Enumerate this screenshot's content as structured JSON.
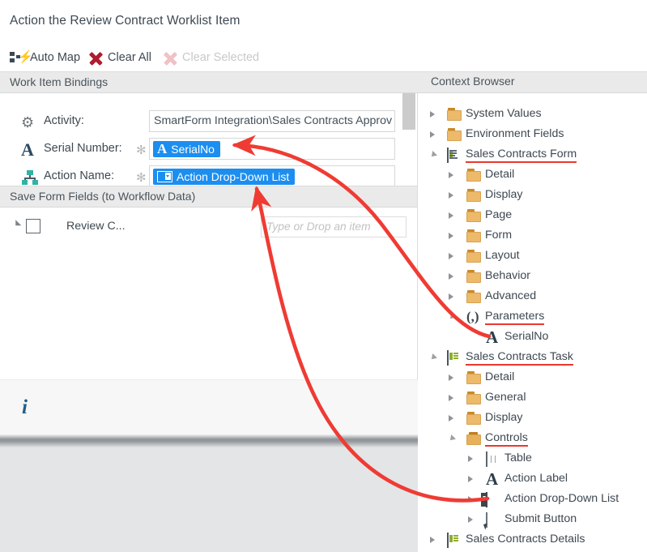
{
  "window": {
    "title": "Action the Review Contract Worklist Item"
  },
  "toolbar": {
    "buttons": [
      {
        "label": "Auto Map",
        "icon": "auto-map-icon",
        "enabled": true
      },
      {
        "label": "Clear All",
        "icon": "red-x-icon",
        "enabled": true
      },
      {
        "label": "Clear Selected",
        "icon": "red-x-icon",
        "enabled": false
      }
    ]
  },
  "panels": {
    "left_header": "Work Item Bindings",
    "right_header": "Context Browser",
    "save_section_header": "Save Form Fields (to Workflow Data)"
  },
  "bindings": {
    "rows": [
      {
        "icon": "gear-icon",
        "label": "Activity:",
        "required": false,
        "value_type": "text",
        "value": "SmartForm Integration\\Sales Contracts Approv"
      },
      {
        "icon": "letter-a-icon",
        "label": "Serial Number:",
        "required": true,
        "required_mark": "✻",
        "value_type": "chip",
        "chip_icon": "letter-a-icon",
        "value": "SerialNo"
      },
      {
        "icon": "org-chart-icon",
        "label": "Action Name:",
        "required": true,
        "required_mark": "✻",
        "value_type": "chip",
        "chip_icon": "drop-down-list-icon",
        "value": "Action Drop-Down List"
      }
    ]
  },
  "save_form_fields": {
    "row": {
      "label": "Review C...",
      "checked": false,
      "drop_placeholder": "Type or Drop an item"
    }
  },
  "info_panel": {
    "icon": "info-icon",
    "text": ""
  },
  "context_browser": {
    "nodes": [
      {
        "label": "System Values",
        "indent": 0,
        "icon": "folder-icon",
        "toggle": "closed",
        "underline": false
      },
      {
        "label": "Environment Fields",
        "indent": 0,
        "icon": "folder-icon",
        "toggle": "closed",
        "underline": false
      },
      {
        "label": "Sales Contracts Form",
        "indent": 0,
        "icon": "form-icon",
        "toggle": "open",
        "underline": true
      },
      {
        "label": "Detail",
        "indent": 1,
        "icon": "folder-icon",
        "toggle": "closed",
        "underline": false
      },
      {
        "label": "Display",
        "indent": 1,
        "icon": "folder-icon",
        "toggle": "closed",
        "underline": false
      },
      {
        "label": "Page",
        "indent": 1,
        "icon": "folder-icon",
        "toggle": "closed",
        "underline": false
      },
      {
        "label": "Form",
        "indent": 1,
        "icon": "folder-icon",
        "toggle": "closed",
        "underline": false
      },
      {
        "label": "Layout",
        "indent": 1,
        "icon": "folder-icon",
        "toggle": "closed",
        "underline": false
      },
      {
        "label": "Behavior",
        "indent": 1,
        "icon": "folder-icon",
        "toggle": "closed",
        "underline": false
      },
      {
        "label": "Advanced",
        "indent": 1,
        "icon": "folder-icon",
        "toggle": "closed",
        "underline": false
      },
      {
        "label": "Parameters",
        "indent": 1,
        "icon": "parameters-icon",
        "toggle": "open",
        "underline": true
      },
      {
        "label": "SerialNo",
        "indent": 2,
        "icon": "letter-a-icon",
        "toggle": "none",
        "underline": false
      },
      {
        "label": "Sales Contracts Task",
        "indent": 0,
        "icon": "task-icon",
        "toggle": "open",
        "underline": true
      },
      {
        "label": "Detail",
        "indent": 1,
        "icon": "folder-icon",
        "toggle": "closed",
        "underline": false
      },
      {
        "label": "General",
        "indent": 1,
        "icon": "folder-icon",
        "toggle": "closed",
        "underline": false
      },
      {
        "label": "Display",
        "indent": 1,
        "icon": "folder-icon",
        "toggle": "closed",
        "underline": false
      },
      {
        "label": "Controls",
        "indent": 1,
        "icon": "folder-open-icon",
        "toggle": "open",
        "underline": true
      },
      {
        "label": "Table",
        "indent": 2,
        "icon": "table-icon",
        "toggle": "closed",
        "underline": false
      },
      {
        "label": "Action Label",
        "indent": 2,
        "icon": "letter-a-icon",
        "toggle": "closed",
        "underline": false
      },
      {
        "label": "Action Drop-Down List",
        "indent": 2,
        "icon": "drop-down-list-icon",
        "toggle": "closed",
        "underline": false
      },
      {
        "label": "Submit Button",
        "indent": 2,
        "icon": "submit-button-icon",
        "toggle": "closed",
        "underline": false
      },
      {
        "label": "Sales Contracts Details",
        "indent": 0,
        "icon": "task-icon",
        "toggle": "closed",
        "underline": false
      }
    ]
  },
  "annotations": {
    "color": "#ef3b33",
    "arrows": [
      {
        "from": "context-browser SerialNo",
        "to": "Serial Number binding chip"
      },
      {
        "from": "context-browser Action Drop-Down List",
        "to": "Action Name binding chip"
      }
    ]
  }
}
